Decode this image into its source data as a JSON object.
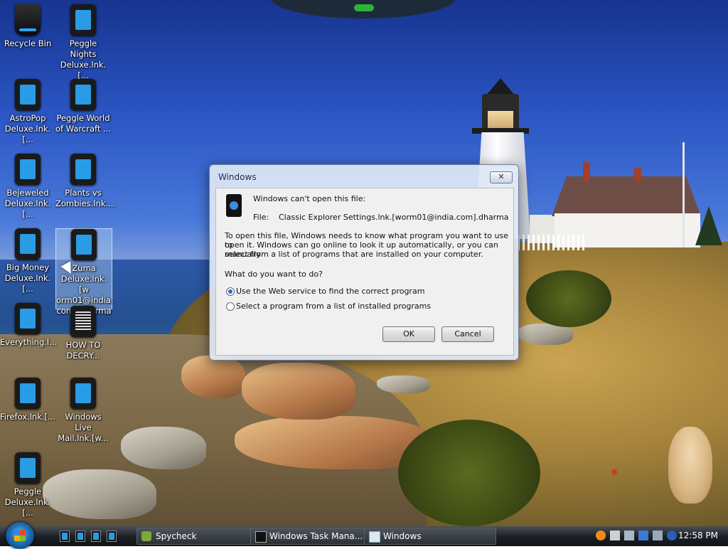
{
  "desktop": {
    "icons": [
      {
        "label": "Recycle Bin"
      },
      {
        "label": "Peggle Nights\nDeluxe.lnk.[..."
      },
      {
        "label": "AstroPop\nDeluxe.lnk.[..."
      },
      {
        "label": "Peggle World\nof Warcraft ..."
      },
      {
        "label": "Bejeweled\nDeluxe.lnk.[..."
      },
      {
        "label": "Plants vs\nZombies.lnk...."
      },
      {
        "label": "Big Money\nDeluxe.lnk.[..."
      },
      {
        "label": "Zuma\nDeluxe.lnk.[w\norm01@india.\ncom].dharma"
      },
      {
        "label": "Everything.l..."
      },
      {
        "label": "HOW TO\nDECRY..."
      },
      {
        "label": "Firefox.lnk.[..."
      },
      {
        "label": "Windows Live\nMail.lnk.[w..."
      },
      {
        "label": "Peggle\nDeluxe.lnk.[..."
      }
    ]
  },
  "dialog": {
    "title": "Windows",
    "close_label": "✕",
    "heading": "Windows can't open this file:",
    "file_label": "File:",
    "file_name": "Classic Explorer Settings.lnk.[worm01@india.com].dharma",
    "explanation_1": "To open this file, Windows needs to know what program you want to use to",
    "explanation_2": "open it. Windows can go online to look it up automatically, or you can manually",
    "explanation_3": "select from a list of programs that are installed on your computer.",
    "question": "What do you want to do?",
    "options": [
      {
        "label": "Use the Web service to find the correct program",
        "selected": true
      },
      {
        "label": "Select a program from a list of installed programs",
        "selected": false
      }
    ],
    "ok_label": "OK",
    "cancel_label": "Cancel"
  },
  "taskbar": {
    "tasks": [
      {
        "label": "Spycheck"
      },
      {
        "label": "Windows Task Mana..."
      },
      {
        "label": "Windows"
      }
    ],
    "clock": "12:58 PM"
  },
  "colors": {
    "accent": "#2d6ad0",
    "taskbar_dark": "#1e2228",
    "dialog_frame": "#dee8f5"
  }
}
